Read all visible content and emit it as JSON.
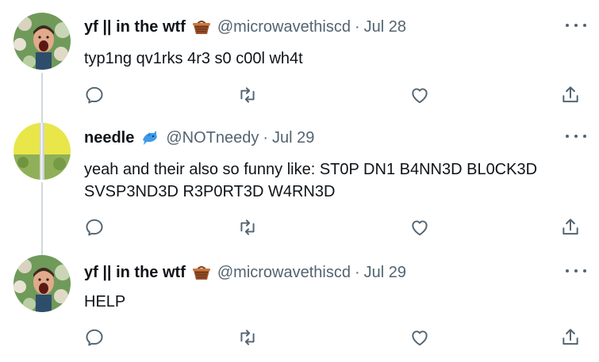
{
  "tweets": [
    {
      "author_name": "yf || in the wtf",
      "author_emoji": "basket-emoji",
      "handle": "@microwavethiscd",
      "separator": "·",
      "date": "Jul 28",
      "text": "typ1ng qv1rks 4r3 s0 c00l wh4t"
    },
    {
      "author_name": "needle",
      "author_emoji": "dolphin-emoji",
      "handle": "@NOTneedy",
      "separator": "·",
      "date": "Jul 29",
      "text": "yeah and their also so funny like: ST0P DN1 B4NN3D BL0CK3D SVSP3ND3D R3P0RT3D W4RN3D"
    },
    {
      "author_name": "yf || in the wtf",
      "author_emoji": "basket-emoji",
      "handle": "@microwavethiscd",
      "separator": "·",
      "date": "Jul 29",
      "text": "HELP"
    }
  ],
  "icons": {
    "reply": "reply-icon",
    "retweet": "retweet-icon",
    "like": "heart-icon",
    "share": "share-icon",
    "more": "more-icon"
  },
  "colors": {
    "text": "#0f1419",
    "secondary": "#536471",
    "thread_line": "#cfd9de",
    "background": "#ffffff"
  }
}
